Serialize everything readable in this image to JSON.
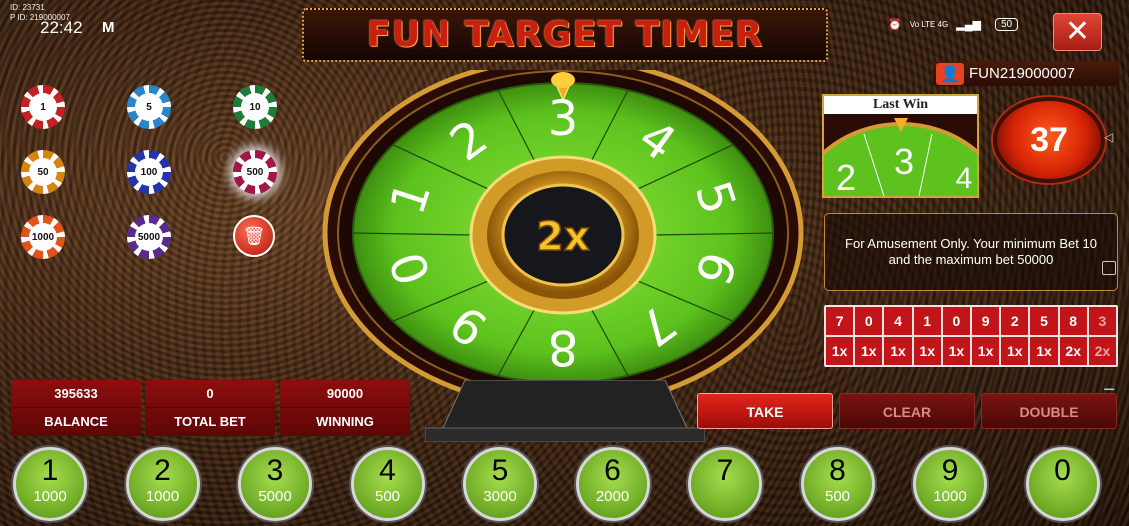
{
  "status": {
    "id_line": "ID: 23731",
    "pid_line": "P ID: 219000007",
    "time": "22:42",
    "carrier_logo": "M",
    "battery": "50",
    "net_label": "Vo LTE 4G"
  },
  "title": "FUN TARGET TIMER",
  "chips": [
    "1",
    "5",
    "10",
    "50",
    "100",
    "500",
    "1000",
    "5000"
  ],
  "chip_colors": [
    "#c42222",
    "#2a86c8",
    "#1d7d39",
    "#d68412",
    "#2335a8",
    "#a1174a",
    "#e2531b",
    "#5a2a8c"
  ],
  "wheel": {
    "numbers": [
      "3",
      "4",
      "5",
      "6",
      "7",
      "8",
      "9",
      "0",
      "1",
      "2"
    ],
    "multiplier": "2x"
  },
  "user": {
    "name": "FUN219000007"
  },
  "last_win": {
    "label": "Last Win",
    "numbers": [
      "2",
      "3",
      "4"
    ]
  },
  "timer": "37",
  "info_text": "For Amusement Only. Your minimum Bet 10 and the maximum bet 50000",
  "history": {
    "numbers": [
      "7",
      "0",
      "4",
      "1",
      "0",
      "9",
      "2",
      "5",
      "8",
      "3"
    ],
    "multipliers": [
      "1x",
      "1x",
      "1x",
      "1x",
      "1x",
      "1x",
      "1x",
      "1x",
      "2x",
      "2x"
    ]
  },
  "stats": {
    "balance_value": "395633",
    "balance_label": "BALANCE",
    "totalbet_value": "0",
    "totalbet_label": "TOTAL BET",
    "winning_value": "90000",
    "winning_label": "WINNING"
  },
  "buttons": {
    "take": "TAKE",
    "clear": "CLEAR",
    "double": "DOUBLE"
  },
  "bets": [
    {
      "n": "1",
      "amount": "1000"
    },
    {
      "n": "2",
      "amount": "1000"
    },
    {
      "n": "3",
      "amount": "5000"
    },
    {
      "n": "4",
      "amount": "500"
    },
    {
      "n": "5",
      "amount": "3000"
    },
    {
      "n": "6",
      "amount": "2000"
    },
    {
      "n": "7",
      "amount": ""
    },
    {
      "n": "8",
      "amount": "500"
    },
    {
      "n": "9",
      "amount": "1000"
    },
    {
      "n": "0",
      "amount": ""
    }
  ]
}
